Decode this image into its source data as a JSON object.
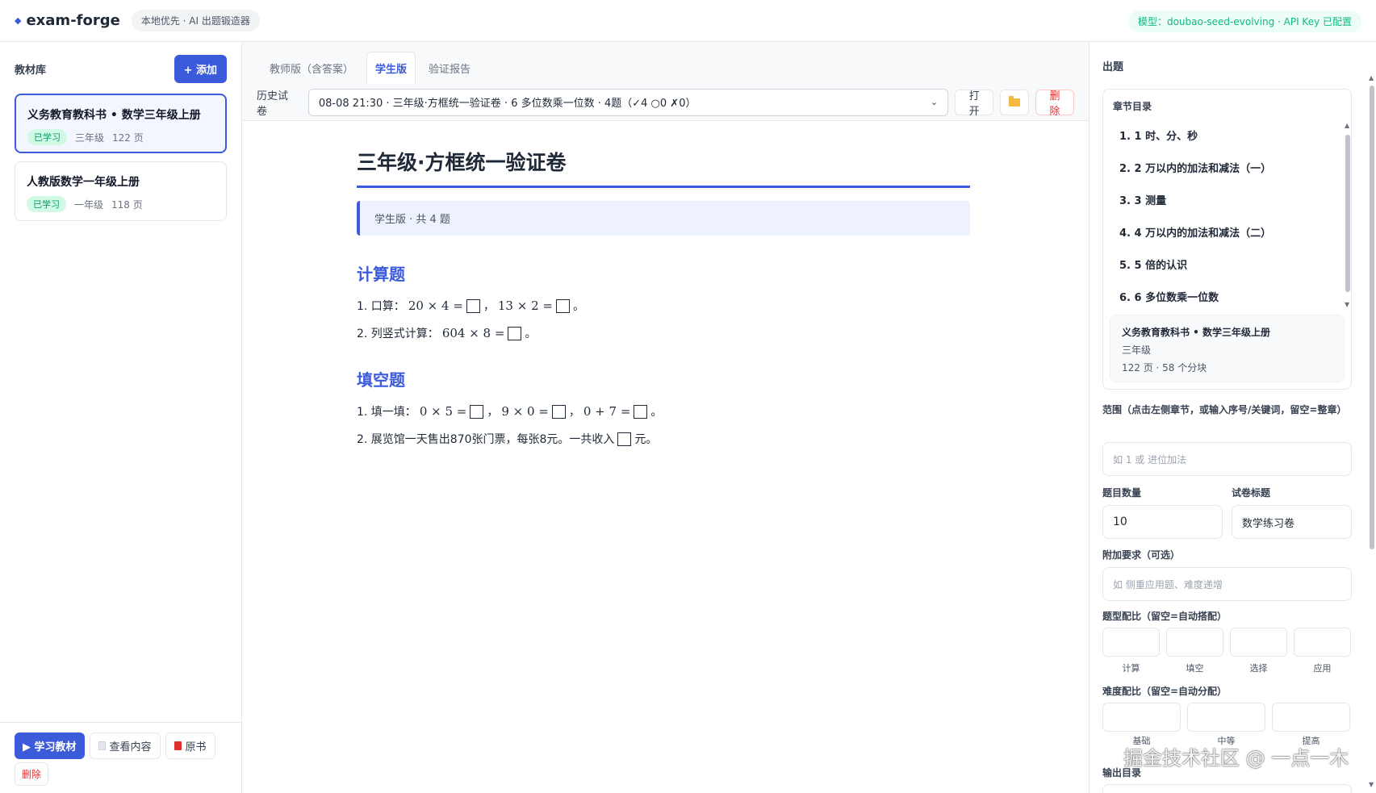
{
  "app": {
    "name": "exam-forge",
    "tagline": "本地优先 · AI 出题锻造器",
    "model_status": "模型：doubao-seed-evolving · API Key 已配置"
  },
  "library": {
    "title": "教材库",
    "add_label": "+ 添加",
    "books": [
      {
        "title": "义务教育教科书 • 数学三年级上册",
        "status": "已学习",
        "grade": "三年级",
        "pages": "122 页"
      },
      {
        "title": "人教版数学一年级上册",
        "status": "已学习",
        "grade": "一年级",
        "pages": "118 页"
      }
    ],
    "actions": {
      "learn": "▶ 学习教材",
      "view": "查看内容",
      "original": "原书",
      "delete": "删除"
    }
  },
  "main": {
    "tabs": [
      "教师版（含答案）",
      "学生版",
      "验证报告"
    ],
    "active_tab": "学生版",
    "history_label": "历史试卷",
    "history_selected": "08-08 21:30 · 三年级·方框统一验证卷 · 6 多位数乘一位数 · 4题（✓4 ○0 ✗0）",
    "open_label": "打开",
    "delete_label": "删除",
    "paper": {
      "title": "三年级·方框统一验证卷",
      "subtitle": "学生版 · 共 4 题",
      "sections": [
        {
          "title": "计算题",
          "questions": [
            {
              "prefix": "1. 口算：",
              "expr1": "20 × 4 =",
              "expr2": "13 × 2 ="
            },
            {
              "prefix": "2. 列竖式计算：",
              "expr1": "604 × 8 ="
            }
          ]
        },
        {
          "title": "填空题",
          "questions": [
            {
              "prefix": "1. 填一填：",
              "expr1": "0 × 5 =",
              "expr2": "9 × 0 =",
              "expr3": "0 + 7 ="
            },
            {
              "prefix": "2. 展览馆一天售出870张门票，每张8元。一共收入",
              "suffix": "元。"
            }
          ]
        }
      ]
    }
  },
  "generator": {
    "title": "出题",
    "toc_title": "章节目录",
    "chapters": [
      "1. 1 时、分、秒",
      "2. 2 万以内的加法和减法（一）",
      "3. 3 测量",
      "4. 4 万以内的加法和减法（二）",
      "5. 5 倍的认识",
      "6. 6 多位数乘一位数"
    ],
    "book_info": {
      "title": "义务教育教科书 • 数学三年级上册",
      "grade": "三年级",
      "stats": "122 页 · 58 个分块"
    },
    "scope_label": "范围（点击左侧章节，或输入序号/关键词，留空=整章）",
    "scope_placeholder": "如 1 或 进位加法",
    "count_label": "题目数量",
    "count_value": "10",
    "paper_title_label": "试卷标题",
    "paper_title_value": "数学练习卷",
    "extra_label": "附加要求（可选）",
    "extra_placeholder": "如 侧重应用题、难度递增",
    "type_ratio_label": "题型配比（留空=自动搭配）",
    "type_names": [
      "计算",
      "填空",
      "选择",
      "应用"
    ],
    "difficulty_label": "难度配比（留空=自动分配）",
    "difficulty_names": [
      "基础",
      "中等",
      "提高"
    ],
    "output_label": "输出目录",
    "watermark": "掘金技术社区 @ 一点一木"
  }
}
